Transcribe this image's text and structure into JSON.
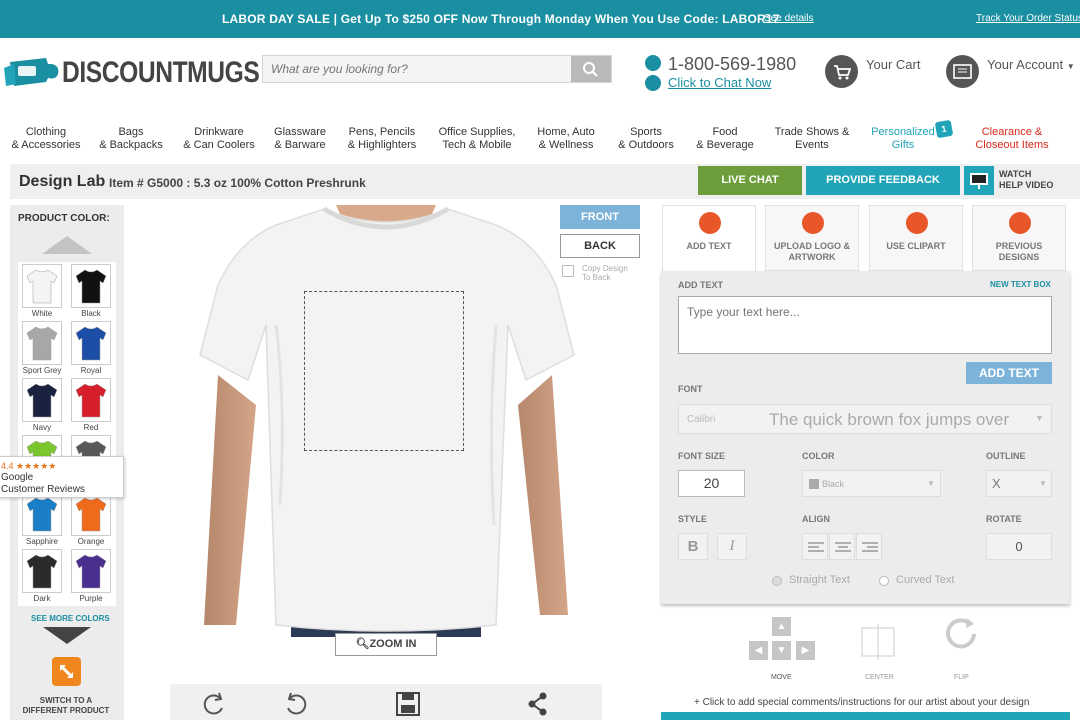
{
  "banner": {
    "text": "LABOR DAY SALE | Get Up To $250 OFF Now Through Monday When You Use Code: LABOR17",
    "see_details": "See details",
    "track_order": "Track Your Order Status"
  },
  "header": {
    "logo": "DISCOUNTMUGS",
    "search_placeholder": "What are you looking for?",
    "phone": "1-800-569-1980",
    "chat_link": "Click to Chat Now",
    "cart_label": "Your Cart",
    "account_label": "Your Account"
  },
  "nav": [
    {
      "line1": "Clothing",
      "line2": "& Accessories",
      "color": "#333333"
    },
    {
      "line1": "Bags",
      "line2": "& Backpacks",
      "color": "#333333"
    },
    {
      "line1": "Drinkware",
      "line2": "& Can Coolers",
      "color": "#333333"
    },
    {
      "line1": "Glassware",
      "line2": "& Barware",
      "color": "#333333"
    },
    {
      "line1": "Pens, Pencils",
      "line2": "& Highlighters",
      "color": "#333333"
    },
    {
      "line1": "Office Supplies,",
      "line2": "Tech & Mobile",
      "color": "#333333"
    },
    {
      "line1": "Home, Auto",
      "line2": "& Wellness",
      "color": "#333333"
    },
    {
      "line1": "Sports",
      "line2": "& Outdoors",
      "color": "#333333"
    },
    {
      "line1": "Food",
      "line2": "& Beverage",
      "color": "#333333"
    },
    {
      "line1": "Trade Shows &",
      "line2": "Events",
      "color": "#333333"
    },
    {
      "line1": "Personalized",
      "line2": "Gifts",
      "color": "#21a4b7",
      "badge": "1"
    },
    {
      "line1": "Clearance &",
      "line2": "Closeout Items",
      "color": "#d9281c"
    }
  ],
  "lab": {
    "title": "Design Lab",
    "item": "Item # G5000 : 5.3 oz 100% Cotton Preshrunk",
    "live_chat": "LIVE CHAT",
    "feedback": "PROVIDE FEEDBACK",
    "watch1": "WATCH",
    "watch2": "HELP VIDEO"
  },
  "colors": {
    "heading": "PRODUCT COLOR:",
    "swatches": [
      {
        "name": "White",
        "hex": "#f4f4f4"
      },
      {
        "name": "Black",
        "hex": "#111111"
      },
      {
        "name": "Sport Grey",
        "hex": "#a7a7a7"
      },
      {
        "name": "Royal",
        "hex": "#1c4ea8"
      },
      {
        "name": "Navy",
        "hex": "#1b2240"
      },
      {
        "name": "Red",
        "hex": "#d71f2b"
      },
      {
        "name": "",
        "hex": "#7bc62e"
      },
      {
        "name": "",
        "hex": "#595959"
      },
      {
        "name": "Sapphire",
        "hex": "#1a7fc8"
      },
      {
        "name": "Orange",
        "hex": "#f06a1b"
      },
      {
        "name": "Dark",
        "hex": "#2b2b2b"
      },
      {
        "name": "Purple",
        "hex": "#4b2f8f"
      }
    ],
    "see_more": "SEE MORE COLORS",
    "switch_line1": "SWITCH TO A",
    "switch_line2": "DIFFERENT PRODUCT"
  },
  "google": {
    "rating": "4.4 ★★★★★",
    "name": "Google",
    "reviews": "Customer Reviews"
  },
  "canvas": {
    "front": "FRONT",
    "back": "BACK",
    "copy1": "Copy Design",
    "copy2": "To Back",
    "zoom": "ZOOM IN"
  },
  "tools": [
    {
      "line1": "ADD TEXT",
      "line2": ""
    },
    {
      "line1": "UPLOAD LOGO &",
      "line2": "ARTWORK"
    },
    {
      "line1": "USE CLIPART",
      "line2": ""
    },
    {
      "line1": "PREVIOUS",
      "line2": "DESIGNS"
    }
  ],
  "panel": {
    "add_text_label": "ADD TEXT",
    "new_box": "NEW TEXT BOX",
    "text_placeholder": "Type your text here...",
    "add_text_btn": "ADD TEXT",
    "font_label": "FONT",
    "font_name": "Calibri",
    "font_sample": "The quick brown fox jumps over",
    "font_size_label": "FONT SIZE",
    "font_size": "20",
    "color_label": "COLOR",
    "color_value": "Black",
    "outline_label": "OUTLINE",
    "outline_value": "X",
    "style_label": "STYLE",
    "bold": "B",
    "italic": "I",
    "align_label": "ALIGN",
    "rotate_label": "ROTATE",
    "rotate_value": "0",
    "straight": "Straight Text",
    "curved": "Curved Text"
  },
  "controls": {
    "move": "MOVE",
    "center": "CENTER",
    "flip": "FLIP",
    "comments": "+ Click to add special comments/instructions for our artist about your design"
  }
}
